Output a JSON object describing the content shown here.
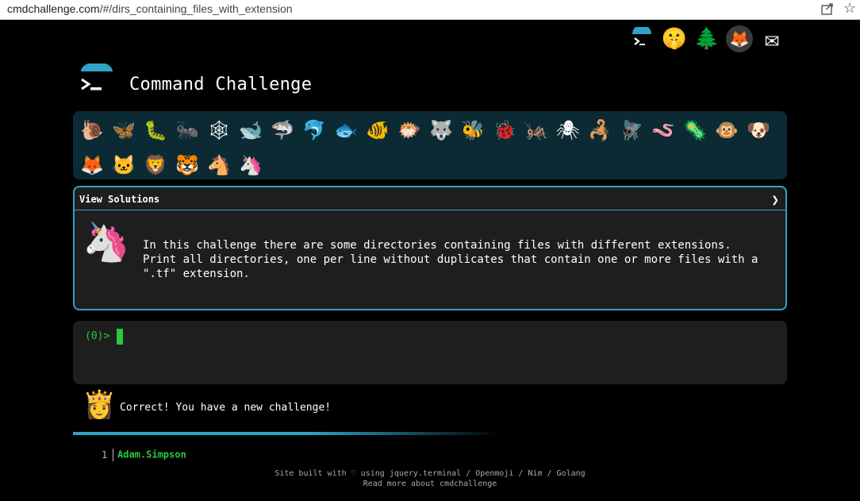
{
  "browser": {
    "url_host": "cmdchallenge.com",
    "url_path": "/#/dirs_containing_files_with_extension"
  },
  "top_links": [
    {
      "name": "cmdchallenge-icon",
      "glyph": ">_"
    },
    {
      "name": "shushing-face-icon",
      "glyph": "🤫"
    },
    {
      "name": "tree-icon",
      "glyph": "🌲"
    },
    {
      "name": "gitlab-icon",
      "glyph": "🦊"
    },
    {
      "name": "envelope-icon",
      "glyph": "✉"
    }
  ],
  "site": {
    "title": "Command Challenge"
  },
  "animals": [
    {
      "name": "snail",
      "glyph": "🐌",
      "done": true
    },
    {
      "name": "butterfly",
      "glyph": "🦋",
      "done": true
    },
    {
      "name": "caterpillar",
      "glyph": "🐛",
      "done": true
    },
    {
      "name": "ant",
      "glyph": "🐜",
      "done": true
    },
    {
      "name": "spider-web",
      "glyph": "🕸",
      "done": true
    },
    {
      "name": "whale",
      "glyph": "🐋",
      "done": true
    },
    {
      "name": "shark",
      "glyph": "🦈",
      "done": true
    },
    {
      "name": "dolphin",
      "glyph": "🐬",
      "done": true
    },
    {
      "name": "fish",
      "glyph": "🐟",
      "done": true
    },
    {
      "name": "tropical-fish",
      "glyph": "🐠",
      "done": true
    },
    {
      "name": "blowfish",
      "glyph": "🐡",
      "done": true
    },
    {
      "name": "wolf",
      "glyph": "🐺",
      "done": true
    },
    {
      "name": "bee",
      "glyph": "🐝",
      "done": true
    },
    {
      "name": "ladybug",
      "glyph": "🐞",
      "done": true
    },
    {
      "name": "cricket",
      "glyph": "🦗",
      "done": true
    },
    {
      "name": "spider",
      "glyph": "🕷",
      "done": true
    },
    {
      "name": "scorpion",
      "glyph": "🦂",
      "done": true
    },
    {
      "name": "fly",
      "glyph": "🪰",
      "done": true
    },
    {
      "name": "worm",
      "glyph": "🪱",
      "done": true
    },
    {
      "name": "microbe",
      "glyph": "🦠",
      "done": true
    },
    {
      "name": "monkey",
      "glyph": "🐵",
      "done": true
    },
    {
      "name": "dog",
      "glyph": "🐶",
      "done": true
    },
    {
      "name": "fox",
      "glyph": "🦊",
      "done": true
    },
    {
      "name": "cat",
      "glyph": "🐱",
      "done": true
    },
    {
      "name": "lion",
      "glyph": "🦁",
      "done": true
    },
    {
      "name": "tiger",
      "glyph": "🐯",
      "done": true
    },
    {
      "name": "horse",
      "glyph": "🐴",
      "done": true
    },
    {
      "name": "unicorn",
      "glyph": "🦄",
      "done": true
    }
  ],
  "challenge": {
    "view_solutions_label": "View Solutions",
    "chevron": "❯",
    "icon": "🦄",
    "description": "In this challenge there are some directories containing files with different extensions.\nPrint all directories, one per line without duplicates that contain one or more files with a\n\".tf\" extension."
  },
  "terminal": {
    "prompt": "(0)>",
    "input_value": ""
  },
  "message": {
    "icon": "👸",
    "text": "Correct! You have a new challenge!"
  },
  "leaderboard": [
    {
      "rank": "1",
      "name": "Adam.Simpson"
    }
  ],
  "footer": {
    "line1": "Site built with ♡ using jquery.terminal / Openmoji / Nim / Golang",
    "line2": "Read more about cmdchallenge"
  },
  "colors": {
    "accent": "#2ea3c6",
    "prompt_green": "#27c93f",
    "panel_bg": "#1e1e1e",
    "animals_bg": "#0b2a33"
  }
}
